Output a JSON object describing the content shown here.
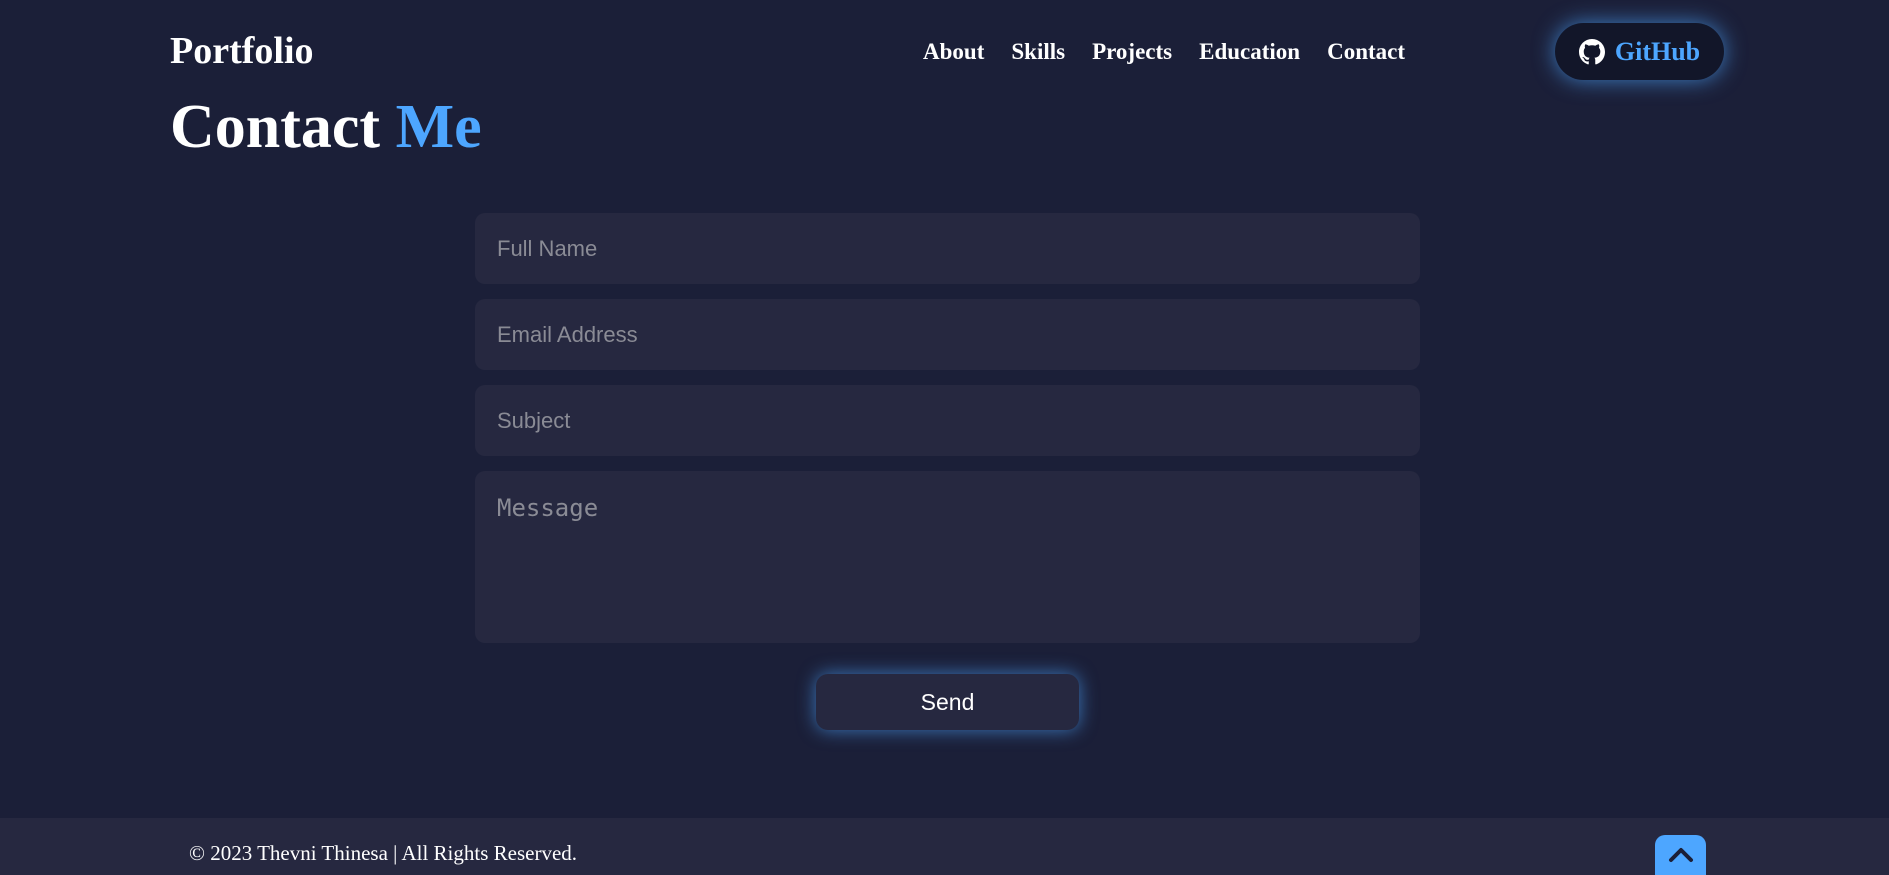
{
  "header": {
    "logo": "Portfolio",
    "nav": [
      "About",
      "Skills",
      "Projects",
      "Education",
      "Contact"
    ],
    "github_label": "GitHub",
    "github_icon": "github-icon"
  },
  "section": {
    "title_main": "Contact",
    "title_accent": "Me"
  },
  "form": {
    "full_name_placeholder": "Full Name",
    "email_placeholder": "Email Address",
    "subject_placeholder": "Subject",
    "message_placeholder": "Message",
    "full_name_value": "",
    "email_value": "",
    "subject_value": "",
    "message_value": "",
    "send_label": "Send"
  },
  "footer": {
    "copyright": "© 2023 Thevni Thinesa | All Rights Reserved.",
    "back_to_top_icon": "chevron-up-icon"
  },
  "colors": {
    "background": "#1b1f38",
    "panel": "#262840",
    "accent": "#4da6ff",
    "text": "#ffffff",
    "placeholder": "#8a8b95"
  }
}
